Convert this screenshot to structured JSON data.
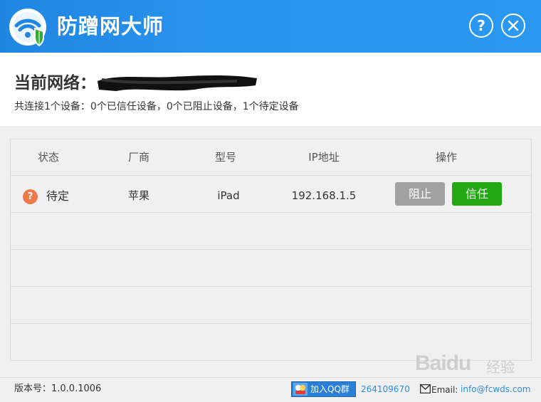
{
  "window": {
    "title": "防蹭网大师",
    "help_icon": "question-circle-icon",
    "close_icon": "close-circle-icon",
    "accent_color": "#2a95ef"
  },
  "network": {
    "label": "当前网络：",
    "summary": "共连接1个设备：0个已信任设备，0个已阻止设备，1个待定设备"
  },
  "table": {
    "headers": [
      "状态",
      "厂商",
      "型号",
      "IP地址",
      "操作"
    ],
    "rows": [
      {
        "status": "待定",
        "status_icon": "question-icon",
        "status_color": "#ec7a4c",
        "vendor": "苹果",
        "model": "iPad",
        "ip": "192.168.1.5",
        "block_label": "阻止",
        "trust_label": "信任"
      }
    ]
  },
  "footer": {
    "version": "版本号：1.0.0.1006",
    "qq_group_label": "加入QQ群",
    "qq_number": "264109670",
    "email_label": "Email:",
    "email_value": "info@fcwds.com"
  },
  "watermark": {
    "text": "Baidu",
    "cn": "经验"
  }
}
